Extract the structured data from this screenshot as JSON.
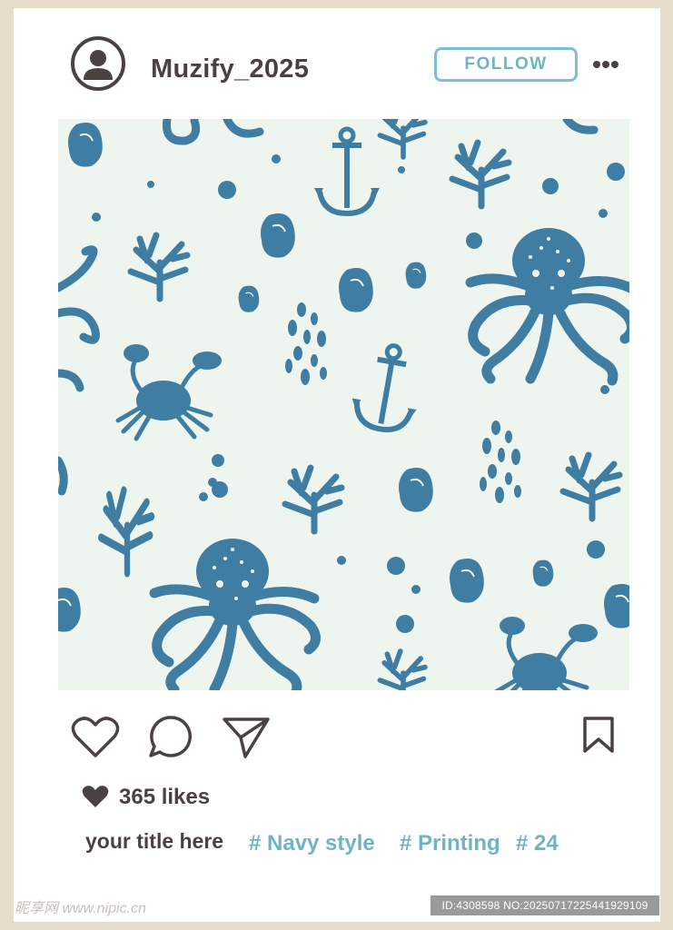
{
  "post": {
    "username": "Muzify_2025",
    "follow_label": "FOLLOW",
    "likes": "365 likes",
    "caption_title": "your title here",
    "tags": [
      "# Navy style",
      "# Printing",
      "# 24"
    ]
  },
  "icons": {
    "avatar": "user-icon",
    "more": "more-horizontal-icon",
    "like": "heart-icon",
    "comment": "comment-bubble-icon",
    "share": "paper-plane-icon",
    "save": "bookmark-icon",
    "likes": "filled-heart-icon"
  },
  "colors": {
    "frame": "#e6dcca",
    "card": "#ffffff",
    "text_dark": "#4a4240",
    "accent": "#6fb3c8",
    "pattern_bg": "#eef5ee",
    "pattern_ink": "#3f7ea2"
  },
  "watermark": {
    "left": "昵享网 www.nipic.cn",
    "right": "ID:4308598 NO:20250717225441929109"
  }
}
